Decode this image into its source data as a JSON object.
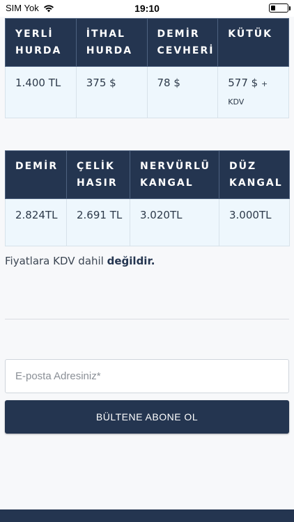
{
  "status_bar": {
    "carrier": "SIM Yok",
    "time": "19:10"
  },
  "scrap_table": {
    "headers": [
      "YERLİ HURDA",
      "İTHAL HURDA",
      "DEMİR CEVHERİ",
      "KÜTÜK"
    ],
    "values": [
      "1.400 TL",
      "375 $",
      "78 $",
      "577 $"
    ],
    "kutuk_suffix": "+ KDV"
  },
  "steel_table": {
    "headers": [
      "DEMİR",
      "ÇELİK HASIR",
      "NERVÜRLÜ KANGAL",
      "DÜZ KANGAL"
    ],
    "values": [
      "2.824TL",
      "2.691 TL",
      "3.020TL",
      "3.000TL"
    ]
  },
  "kdv_note": {
    "text": "Fiyatlara KDV dahil",
    "emphasis": "değildir."
  },
  "newsletter": {
    "email_placeholder": "E-posta Adresiniz*",
    "email_value": "",
    "subscribe_label": "BÜLTENE ABONE OL"
  },
  "colors": {
    "header_bg": "#243550",
    "cell_bg": "#eef7fd",
    "button_bg": "#243550"
  },
  "icons": [
    "wifi-icon",
    "battery-icon"
  ]
}
